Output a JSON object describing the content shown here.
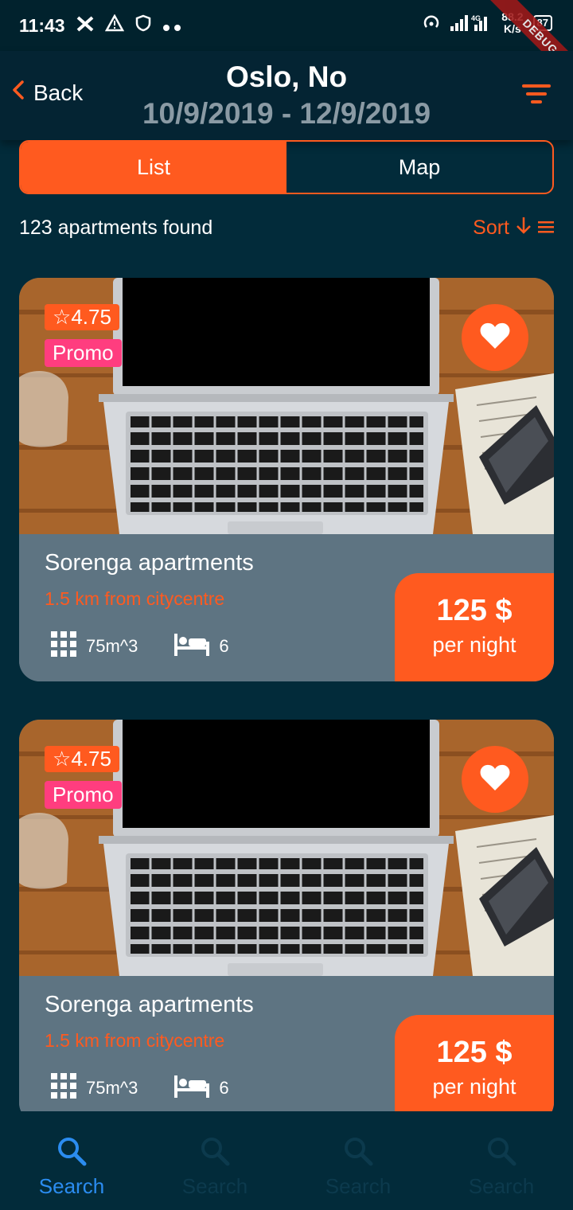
{
  "status_bar": {
    "time": "11:43",
    "speed_value": "88.2",
    "speed_unit": "K/s",
    "battery": "87",
    "network": "4G",
    "debug_label": "DEBUG"
  },
  "app_bar": {
    "back_label": "Back",
    "title": "Oslo, No",
    "dates": "10/9/2019 - 12/9/2019"
  },
  "view_toggle": {
    "list_label": "List",
    "map_label": "Map",
    "selected": "List"
  },
  "results": {
    "count_text": "123 apartments found",
    "sort_label": "Sort"
  },
  "listings": [
    {
      "rating": "4.75",
      "promo": "Promo",
      "name": "Sorenga apartments",
      "distance": "1.5 km from citycentre",
      "area": "75m^3",
      "beds": "6",
      "price": "125 $",
      "per_night": "per night"
    },
    {
      "rating": "4.75",
      "promo": "Promo",
      "name": "Sorenga apartments",
      "distance": "1.5 km from citycentre",
      "area": "75m^3",
      "beds": "6",
      "price": "125 $",
      "per_night": "per night"
    }
  ],
  "bottom_nav": [
    {
      "label": "Search",
      "icon": "search-icon",
      "active": true
    },
    {
      "label": "Search",
      "icon": "search-icon",
      "active": false
    },
    {
      "label": "Search",
      "icon": "search-icon",
      "active": false
    },
    {
      "label": "Search",
      "icon": "search-icon",
      "active": false
    }
  ],
  "colors": {
    "accent": "#ff5a1f",
    "background": "#022b3a",
    "promo": "#ff3d7f",
    "card_info": "#5e7482",
    "nav_active": "#2b8cf0"
  }
}
